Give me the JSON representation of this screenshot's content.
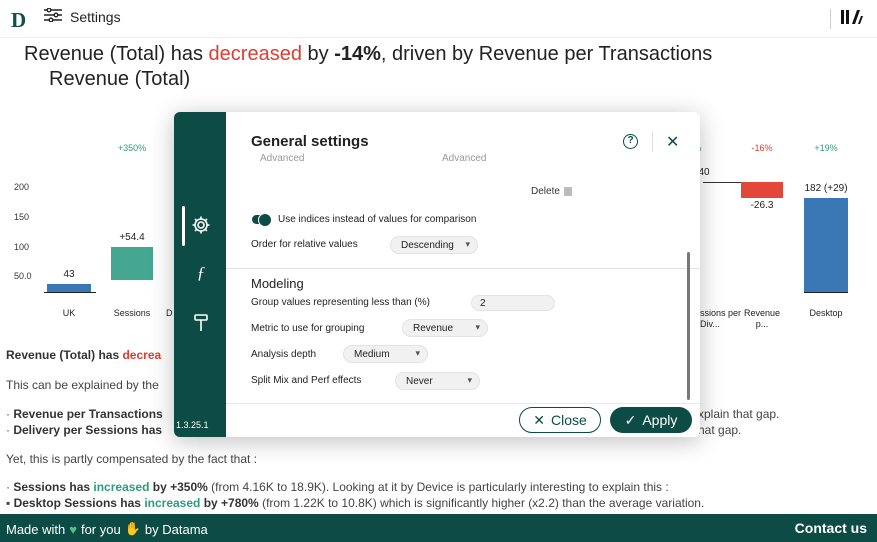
{
  "topbar": {
    "logo": "D",
    "settings_label": "Settings"
  },
  "headline": {
    "part1": "Revenue (Total) has ",
    "trend_word": "decreased",
    "part2": " by ",
    "change": "-14%",
    "part3": ", driven by Revenue per Transactions",
    "line2": "Revenue (Total)"
  },
  "chart_data": {
    "type": "bar",
    "subtype": "waterfall",
    "y_ticks": [
      "200",
      "150",
      "100",
      "50.0"
    ],
    "bars": [
      {
        "category": "UK",
        "value": 43,
        "label": "43",
        "color": "#3a78b5",
        "pct": ""
      },
      {
        "category": "Sessions",
        "value": 54.4,
        "label": "+54.4",
        "color": "#45a792",
        "pct": "+350%"
      },
      {
        "category": "D",
        "value": null,
        "label": "",
        "color": "",
        "pct": ""
      },
      {
        "category": "...sions per\nDiv...",
        "value": null,
        "label": "40",
        "color": "#45a792",
        "pct": "5%"
      },
      {
        "category": "Revenue\np...",
        "value": -26.3,
        "label": "-26.3",
        "color": "#e2483a",
        "pct": "-16%"
      },
      {
        "category": "Desktop",
        "value": 182,
        "label": "182 (+29)",
        "color": "#3a78b5",
        "pct": "+19%"
      }
    ]
  },
  "text_block": {
    "l1_a": "Revenue (Total) has ",
    "l1_b": "decrea",
    "l2": "This can be explained by the",
    "l3_a": "· ",
    "l3_b": "Revenue per Transactions",
    "l3_right": "xplain that gap.",
    "l4_a": "· ",
    "l4_b": "Delivery per Sessions has",
    "l4_right": "hat gap.",
    "l5": "Yet, this is partly compensated by the fact that :",
    "l6_a": "· ",
    "l6_b": "Sessions has ",
    "l6_c": "increased",
    "l6_d": " by +350%",
    "l6_e": " (from 4.16K to 18.9K). Looking at it by Device is particularly interesting to explain this :",
    "l7_a": "  ▪ ",
    "l7_b": "Desktop Sessions has ",
    "l7_c": "increased",
    "l7_d": " by +780%",
    "l7_e": " (from 1.22K to 10.8K) which is significantly higher (x2.2) than the average variation."
  },
  "footer": {
    "made_with": "Made with",
    "for_you": "for you",
    "by": "by Datama",
    "contact": "Contact us"
  },
  "modal": {
    "title": "General settings",
    "version": "1.3.25.1",
    "faded_left": "Advanced",
    "faded_right": "Advanced",
    "delete_label": "Delete",
    "toggle_label": "Use indices instead of values for comparison",
    "order_label": "Order for relative values",
    "order_value": "Descending",
    "modeling_title": "Modeling",
    "group_label": "Group values representing less than (%)",
    "group_value": "2",
    "metric_label": "Metric to use for grouping",
    "metric_value": "Revenue",
    "depth_label": "Analysis depth",
    "depth_value": "Medium",
    "split_label": "Split Mix and Perf effects",
    "split_value": "Never",
    "close_label": "Close",
    "apply_label": "Apply"
  }
}
